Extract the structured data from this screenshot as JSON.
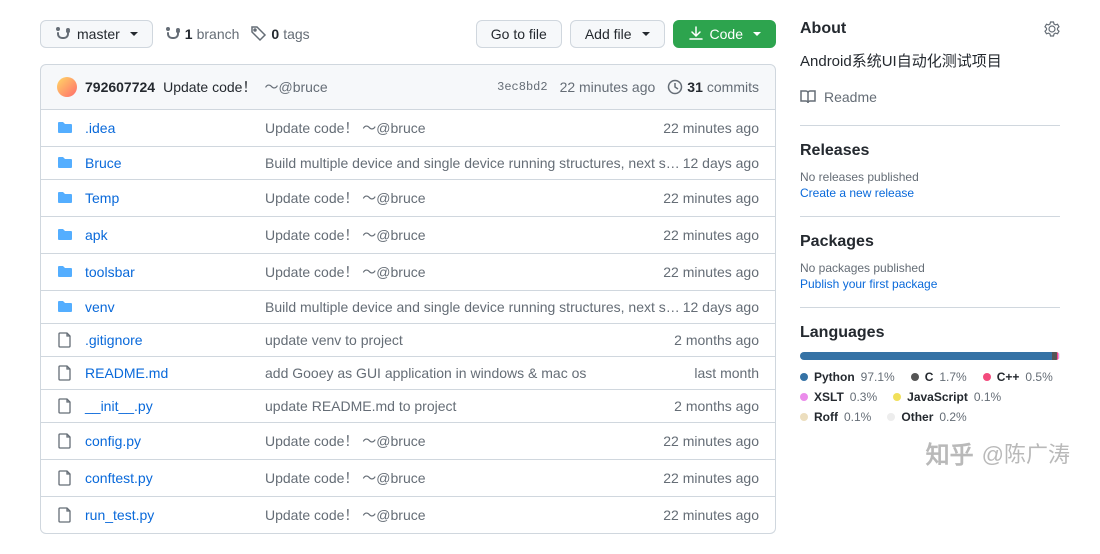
{
  "toolbar": {
    "branch": "master",
    "branches_count": "1",
    "branches_label": "branch",
    "tags_count": "0",
    "tags_label": "tags",
    "go_to_file": "Go to file",
    "add_file": "Add file",
    "code": "Code"
  },
  "commit": {
    "author": "792607724",
    "message": "Update code！",
    "mention": "～@bruce",
    "sha": "3ec8bd2",
    "time": "22 minutes ago",
    "total_commits": "31",
    "commits_label": "commits"
  },
  "files": [
    {
      "type": "dir",
      "name": ".idea",
      "msg": "Update code！",
      "mention": "～@bruce",
      "time": "22 minutes ago"
    },
    {
      "type": "dir",
      "name": "Bruce",
      "msg": "Build multiple device and single device running structures, next step…",
      "mention": "",
      "time": "12 days ago"
    },
    {
      "type": "dir",
      "name": "Temp",
      "msg": "Update code！",
      "mention": "～@bruce",
      "time": "22 minutes ago"
    },
    {
      "type": "dir",
      "name": "apk",
      "msg": "Update code！",
      "mention": "～@bruce",
      "time": "22 minutes ago"
    },
    {
      "type": "dir",
      "name": "toolsbar",
      "msg": "Update code！",
      "mention": "～@bruce",
      "time": "22 minutes ago"
    },
    {
      "type": "dir",
      "name": "venv",
      "msg": "Build multiple device and single device running structures, next step…",
      "mention": "",
      "time": "12 days ago"
    },
    {
      "type": "file",
      "name": ".gitignore",
      "msg": "update venv to project",
      "mention": "",
      "time": "2 months ago"
    },
    {
      "type": "file",
      "name": "README.md",
      "msg": "add Gooey as GUI application in windows & mac os",
      "mention": "",
      "time": "last month"
    },
    {
      "type": "file",
      "name": "__init__.py",
      "msg": "update README.md to project",
      "mention": "",
      "time": "2 months ago"
    },
    {
      "type": "file",
      "name": "config.py",
      "msg": "Update code！",
      "mention": "～@bruce",
      "time": "22 minutes ago"
    },
    {
      "type": "file",
      "name": "conftest.py",
      "msg": "Update code！",
      "mention": "～@bruce",
      "time": "22 minutes ago"
    },
    {
      "type": "file",
      "name": "run_test.py",
      "msg": "Update code！",
      "mention": "～@bruce",
      "time": "22 minutes ago"
    }
  ],
  "about": {
    "title": "About",
    "description": "Android系统UI自动化测试项目",
    "readme": "Readme"
  },
  "releases": {
    "title": "Releases",
    "empty": "No releases published",
    "create": "Create a new release"
  },
  "packages": {
    "title": "Packages",
    "empty": "No packages published",
    "publish": "Publish your first package"
  },
  "languages": {
    "title": "Languages",
    "items": [
      {
        "name": "Python",
        "pct": "97.1%",
        "color": "#3572A5"
      },
      {
        "name": "C",
        "pct": "1.7%",
        "color": "#555555"
      },
      {
        "name": "C++",
        "pct": "0.5%",
        "color": "#f34b7d"
      },
      {
        "name": "XSLT",
        "pct": "0.3%",
        "color": "#EB8CEB"
      },
      {
        "name": "JavaScript",
        "pct": "0.1%",
        "color": "#f1e05a"
      },
      {
        "name": "Roff",
        "pct": "0.1%",
        "color": "#ecdebe"
      },
      {
        "name": "Other",
        "pct": "0.2%",
        "color": "#ededed"
      }
    ]
  },
  "watermark": {
    "site": "知乎",
    "author": "@陈广涛"
  }
}
